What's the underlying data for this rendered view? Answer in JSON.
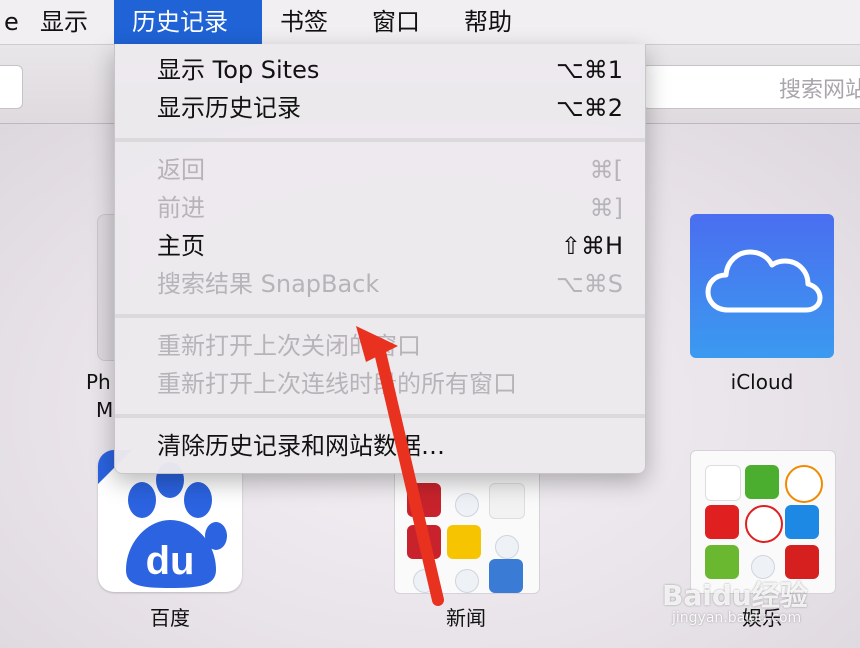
{
  "menubar": {
    "items": [
      {
        "label": "显示"
      },
      {
        "label": "历史记录"
      },
      {
        "label": "书签"
      },
      {
        "label": "窗口"
      },
      {
        "label": "帮助"
      }
    ],
    "active_index": 1,
    "active_color": "#1f63d6"
  },
  "toolbar": {
    "search_placeholder": "搜索网站"
  },
  "history_menu": {
    "groups": [
      [
        {
          "label": "显示 Top Sites",
          "shortcut": "⌥⌘1",
          "enabled": true
        },
        {
          "label": "显示历史记录",
          "shortcut": "⌥⌘2",
          "enabled": true
        }
      ],
      [
        {
          "label": "返回",
          "shortcut": "⌘[",
          "enabled": false
        },
        {
          "label": "前进",
          "shortcut": "⌘]",
          "enabled": false
        },
        {
          "label": "主页",
          "shortcut": "⇧⌘H",
          "enabled": true
        },
        {
          "label": "搜索结果 SnapBack",
          "shortcut": "⌥⌘S",
          "enabled": false
        }
      ],
      [
        {
          "label": "重新打开上次关闭的窗口",
          "shortcut": "",
          "enabled": false
        },
        {
          "label": "重新打开上次连线时段的所有窗口",
          "shortcut": "",
          "enabled": false
        }
      ],
      [
        {
          "label": "清除历史记录和网站数据…",
          "shortcut": "",
          "enabled": true
        }
      ]
    ]
  },
  "top_sites": {
    "phone_label_1": "Ph",
    "phone_label_2": "M",
    "icloud": {
      "label": "iCloud",
      "icon": "cloud-icon"
    },
    "baidu": {
      "label": "百度",
      "logo_text": "du",
      "icon": "baidu-paw-icon"
    },
    "news": {
      "label": "新闻"
    },
    "entertainment": {
      "label": "娱乐"
    }
  },
  "watermark": {
    "text": "Baidu经验",
    "sub": "jingyan.baidu.com"
  },
  "colors": {
    "arrow": "#e8321f",
    "disabled_text": "#b7b4b9",
    "icloud_gradient_top": "#4a6ef0",
    "icloud_gradient_bottom": "#3b9af0",
    "baidu_blue": "#2b63e0"
  }
}
